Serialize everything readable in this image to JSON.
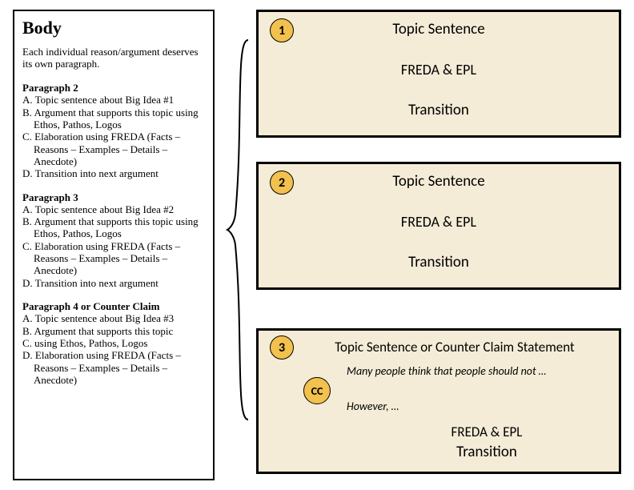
{
  "left": {
    "title": "Body",
    "intro": "Each individual reason/argument deserves its own paragraph.",
    "paragraphs": [
      {
        "heading": "Paragraph 2",
        "a": "A. Topic sentence about Big Idea #1",
        "b": "B. Argument that supports this topic using Ethos, Pathos, Logos",
        "c": "C. Elaboration using FREDA (Facts – Reasons – Examples – Details – Anecdote)",
        "d": "D. Transition into next argument"
      },
      {
        "heading": "Paragraph 3",
        "a": "A. Topic sentence about Big Idea #2",
        "b": "B. Argument that supports this topic using Ethos, Pathos, Logos",
        "c": "C. Elaboration using FREDA (Facts – Reasons – Examples – Details – Anecdote)",
        "d": "D. Transition into next argument"
      },
      {
        "heading": "Paragraph 4 or Counter Claim",
        "a": "A. Topic sentence about Big Idea #3",
        "b": "B. Argument that supports this topic",
        "c": "C. using Ethos, Pathos, Logos",
        "d": "D. Elaboration using FREDA (Facts – Reasons – Examples – Details – Anecdote)"
      }
    ]
  },
  "cards": {
    "card1": {
      "badge": "1",
      "line1": "Topic Sentence",
      "line2": "FREDA & EPL",
      "line3": "Transition"
    },
    "card2": {
      "badge": "2",
      "line1": "Topic Sentence",
      "line2": "FREDA & EPL",
      "line3": "Transition"
    },
    "card3": {
      "badge": "3",
      "badge_cc": "CC",
      "title": "Topic Sentence or Counter Claim Statement",
      "example1": "Many people think that people should not …",
      "example2": "However, …",
      "line_freda": "FREDA & EPL",
      "line_trans": "Transition"
    }
  }
}
